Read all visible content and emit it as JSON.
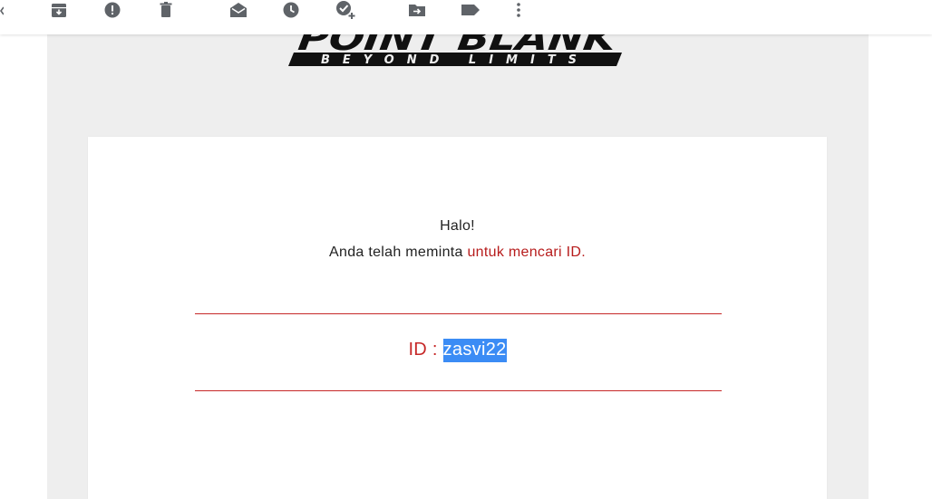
{
  "toolbar": {
    "icons": [
      {
        "name": "archive-icon"
      },
      {
        "name": "report-spam-icon"
      },
      {
        "name": "delete-icon"
      },
      {
        "name": "mark-as-unread-icon"
      },
      {
        "name": "snooze-icon"
      },
      {
        "name": "add-to-tasks-icon"
      },
      {
        "name": "move-to-icon"
      },
      {
        "name": "labels-icon"
      },
      {
        "name": "more-options-icon"
      }
    ],
    "icon_color": "#5f6368"
  },
  "email": {
    "logo": {
      "title": "POINT BLANK",
      "subtitle": "BEYOND LIMITS"
    },
    "greeting": "Halo!",
    "request_prefix": "Anda telah meminta ",
    "request_highlight": "untuk mencari ID.",
    "id_label": "ID : ",
    "id_value": "zasvi22",
    "accent_color": "#c62828",
    "selection_color": "#3b8cf5"
  }
}
